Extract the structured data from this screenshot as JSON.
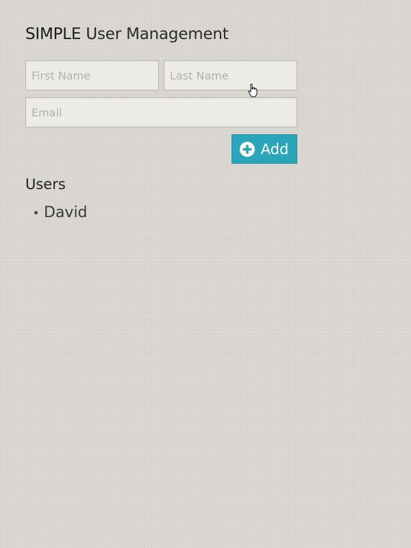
{
  "header": {
    "brand": "SIMPLE",
    "title": "User Management"
  },
  "form": {
    "first_name": {
      "placeholder": "First Name",
      "value": ""
    },
    "last_name": {
      "placeholder": "Last Name",
      "value": ""
    },
    "email": {
      "placeholder": "Email",
      "value": ""
    },
    "add_button": {
      "label": "Add",
      "icon": "plus-circle-icon"
    }
  },
  "users": {
    "heading": "Users",
    "items": [
      {
        "name": "David"
      }
    ]
  },
  "colors": {
    "background": "#dbd7d1",
    "accent": "#2aa6bb",
    "field_background": "#edebe7",
    "field_border": "#b9b5ae"
  }
}
